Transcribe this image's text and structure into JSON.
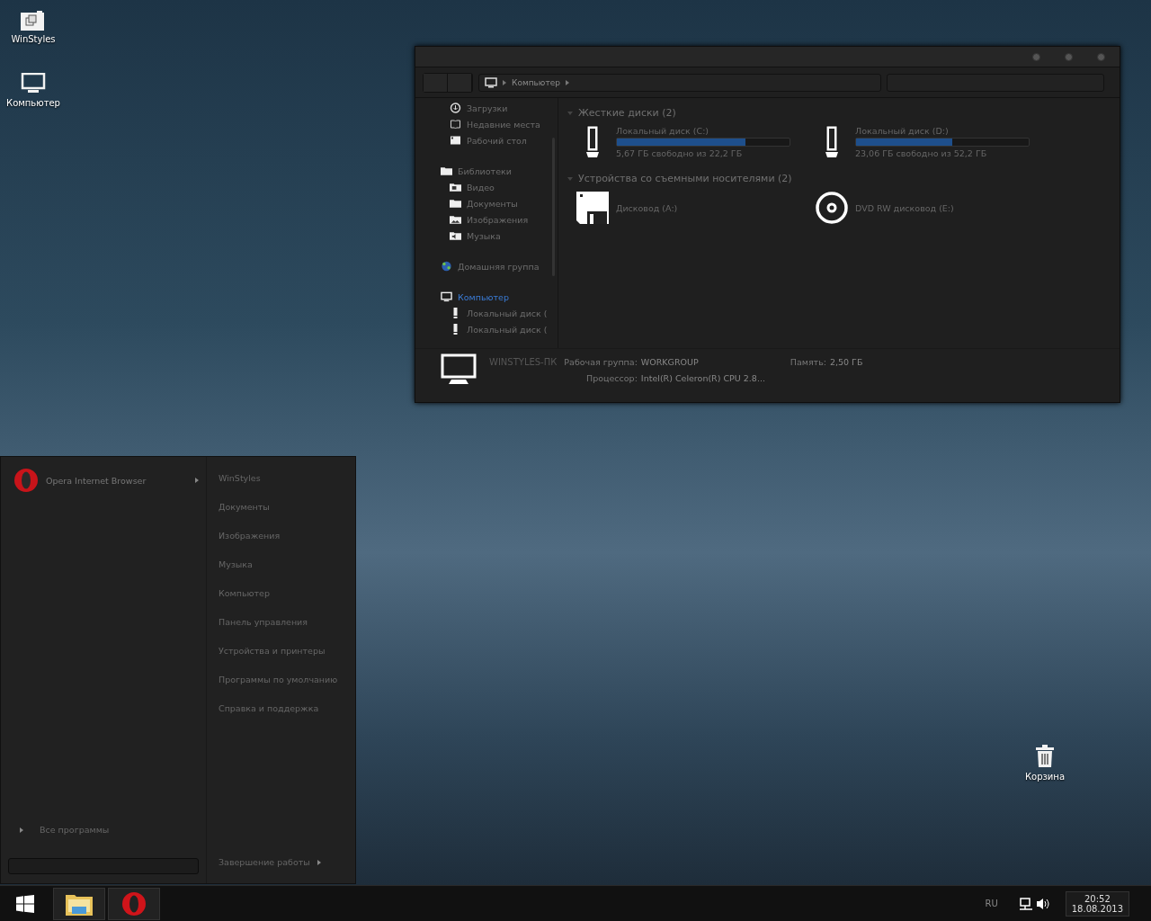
{
  "desktop_icons": [
    {
      "label": "WinStyles",
      "kind": "folder"
    },
    {
      "label": "Компьютер",
      "kind": "computer"
    }
  ],
  "recycle_bin": {
    "label": "Корзина"
  },
  "explorer": {
    "breadcrumb": [
      "Компьютер"
    ],
    "nav": [
      {
        "children": [
          {
            "label": "Загрузки",
            "kind": "download",
            "selected": false
          },
          {
            "label": "Недавние места",
            "kind": "recent",
            "selected": false
          },
          {
            "label": "Рабочий стол",
            "kind": "desktop",
            "selected": false
          }
        ]
      },
      {
        "label": "Библиотеки",
        "kind": "folder",
        "selected": false,
        "children": [
          {
            "label": "Видео",
            "kind": "video",
            "selected": false
          },
          {
            "label": "Документы",
            "kind": "folder",
            "selected": false
          },
          {
            "label": "Изображения",
            "kind": "image",
            "selected": false
          },
          {
            "label": "Музыка",
            "kind": "music",
            "selected": false
          }
        ]
      },
      {
        "label": "Домашняя группа",
        "kind": "homegroup",
        "selected": false
      },
      {
        "label": "Компьютер",
        "kind": "computer",
        "selected": true,
        "children": [
          {
            "label": "Локальный диск (",
            "kind": "drive",
            "selected": false
          },
          {
            "label": "Локальный диск (",
            "kind": "drive",
            "selected": false
          }
        ]
      }
    ],
    "sections": [
      {
        "title": "Жесткие диски (2)",
        "items": [
          {
            "name": "Локальный диск (C:)",
            "kind": "hdd",
            "level": 0.745,
            "info": "5,67 ГБ свободно из 22,2 ГБ"
          },
          {
            "name": "Локальный диск (D:)",
            "kind": "hdd",
            "level": 0.558,
            "info": "23,06 ГБ свободно из 52,2 ГБ"
          }
        ]
      },
      {
        "title": "Устройства со съемными носителями (2)",
        "items": [
          {
            "name": "Дисковод (A:)",
            "kind": "floppy"
          },
          {
            "name": "DVD RW дисковод (E:)",
            "kind": "dvd"
          }
        ]
      }
    ],
    "details": {
      "name": "WINSTYLES-ПК",
      "fields": [
        {
          "label": "Рабочая группа:",
          "value": "WORKGROUP"
        },
        {
          "label": "Память:",
          "value": "2,50 ГБ"
        },
        {
          "label": "Процессор:",
          "value": "Intel(R) Celeron(R) CPU 2.8..."
        }
      ]
    }
  },
  "start_menu": {
    "programs": [
      {
        "label": "Opera Internet Browser",
        "has_submenu": true
      }
    ],
    "all_programs": "Все программы",
    "places": [
      "WinStyles",
      "Документы",
      "Изображения",
      "Музыка",
      "Компьютер",
      "Панель управления",
      "Устройства и принтеры",
      "Программы по умолчанию",
      "Справка и поддержка"
    ],
    "shutdown": "Завершение работы"
  },
  "taskbar": {
    "apps": [
      {
        "kind": "explorer"
      },
      {
        "kind": "opera"
      }
    ],
    "language": "RU",
    "time": "20:52",
    "date": "18.08.2013"
  }
}
